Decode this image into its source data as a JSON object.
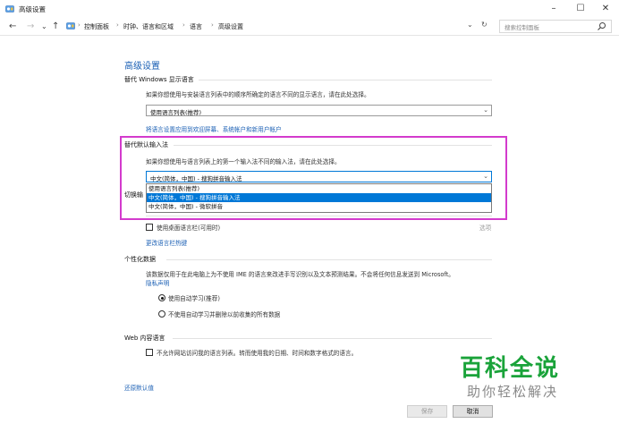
{
  "window": {
    "title": "高级设置",
    "minimize_glyph": "–",
    "maximize_glyph": "☐",
    "close_glyph": "✕"
  },
  "nav": {
    "back_glyph": "←",
    "forward_glyph": "→",
    "recent_glyph": "⌄",
    "up_glyph": "↑",
    "separator": "›",
    "breadcrumb": [
      "控制面板",
      "时钟、语言和区域",
      "语言",
      "高级设置"
    ],
    "dropdown_glyph": "⌄",
    "refresh_glyph": "↻",
    "search_placeholder": "搜索控制面板"
  },
  "page": {
    "title": "高级设置"
  },
  "display_language": {
    "heading": "替代 Windows 显示语言",
    "description": "如果你想使用与安装语言列表中的顺序所确定的语言不同的显示语言，请在此处选择。",
    "selected": "使用语言列表(推荐)",
    "apply_link": "将语言设置应用到欢迎屏幕、系统帐户和新用户帐户"
  },
  "input_method": {
    "heading": "替代默认输入法",
    "description": "如果你想使用与语言列表上的第一个输入法不同的输入法，请在此处选择。",
    "selected": "中文(简体，中国) - 搜狗拼音输入法",
    "options": [
      "使用语言列表(推荐)",
      "中文(简体，中国) - 搜狗拼音输入法",
      "中文(简体，中国) - 微软拼音"
    ],
    "selected_index": 1
  },
  "switching": {
    "heading_partial": "切换输",
    "desktop_bar_label": "使用桌面语言栏(可用时)",
    "options_label": "选项",
    "hotkey_link": "更改语言栏热键"
  },
  "personalization": {
    "heading": "个性化数据",
    "description": "该数据仅用于在此电脑上为不使用 IME 的语言来改进手写识别以及文本预测结果。不会将任何信息发送到 Microsoft。",
    "privacy_link": "隐私声明",
    "radio_auto": "使用自动学习(推荐)",
    "radio_no_auto": "不使用自动学习并删除以前收集的所有数据",
    "radio_auto_checked": true
  },
  "web_language": {
    "heading": "Web 内容语言",
    "checkbox_label": "不允许网站访问我的语言列表。转而使用我的日期、时间和数字格式的语言。"
  },
  "footer": {
    "restore_link": "还原默认值",
    "save_label": "保存",
    "cancel_label": "取消"
  },
  "watermark": {
    "main": "百科全说",
    "sub": "助你轻松解决"
  },
  "colors": {
    "accent_link": "#1a5fb4",
    "selection": "#0078d7",
    "highlight_box": "#d33bcd",
    "watermark_green": "#1aa33a"
  }
}
